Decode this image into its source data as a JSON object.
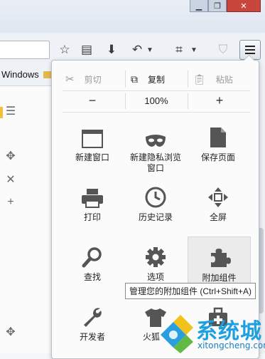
{
  "bookmarks": {
    "label": "Windows"
  },
  "edit": {
    "cut": "剪切",
    "copy": "复制",
    "paste": "粘贴"
  },
  "zoom": {
    "minus": "−",
    "value": "100%",
    "plus": "+"
  },
  "menu": {
    "items": [
      {
        "label": "新建窗口",
        "icon": "window-icon"
      },
      {
        "label": "新建隐私浏览窗口",
        "icon": "mask-icon"
      },
      {
        "label": "保存页面",
        "icon": "page-icon"
      },
      {
        "label": "打印",
        "icon": "printer-icon"
      },
      {
        "label": "历史记录",
        "icon": "clock-icon"
      },
      {
        "label": "全屏",
        "icon": "fullscreen-icon"
      },
      {
        "label": "查找",
        "icon": "magnifier-icon"
      },
      {
        "label": "选项",
        "icon": "gear-icon"
      },
      {
        "label": "附加组件",
        "icon": "puzzle-icon"
      },
      {
        "label": "开发者",
        "icon": "wrench-icon"
      },
      {
        "label": "火狐",
        "icon": "shirt-icon"
      },
      {
        "label": "",
        "icon": "toolbox-icon"
      }
    ]
  },
  "tooltip": "管理您的附加组件 (Ctrl+Shift+A)",
  "watermark": {
    "text": "系统城",
    "url": "xitongcheng.com"
  }
}
